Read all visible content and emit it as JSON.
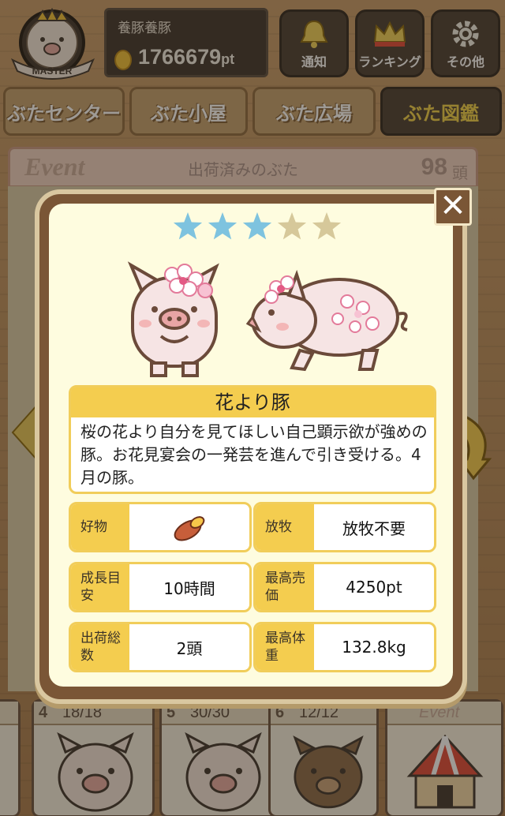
{
  "header": {
    "badge_text": "MASTER",
    "user_name": "養豚養豚",
    "points": "1766679",
    "points_unit": "pt",
    "buttons": [
      {
        "label": "通知",
        "icon": "bell-icon"
      },
      {
        "label": "ランキング",
        "icon": "crown-icon"
      },
      {
        "label": "その他",
        "icon": "gear-icon"
      }
    ]
  },
  "tabs": [
    {
      "label": "ぶたセンター",
      "active": false
    },
    {
      "label": "ぶた小屋",
      "active": false
    },
    {
      "label": "ぶた広場",
      "active": false
    },
    {
      "label": "ぶた図鑑",
      "active": true
    }
  ],
  "event_bar": {
    "event_label": "Event",
    "title": "出荷済みのぶた",
    "count": "98",
    "count_unit": "頭"
  },
  "bottom_cards": [
    {
      "number": "4",
      "count": "18/18"
    },
    {
      "number": "5",
      "count": "30/30"
    },
    {
      "number": "6",
      "count": "12/12"
    },
    {
      "number": "",
      "count": "Event"
    }
  ],
  "modal": {
    "close_label": "✕",
    "rating": {
      "filled": 3,
      "total": 5
    },
    "pig_name": "花より豚",
    "description": "桜の花より自分を見てほしい自己顕示欲が強めの豚。お花見宴会の一発芸を進んで引き受ける。4月の豚。",
    "stats": {
      "favorite": {
        "key": "好物",
        "value_icon": "sweet-potato-icon"
      },
      "grazing": {
        "key": "放牧",
        "value": "放牧不要"
      },
      "growth": {
        "key": "成長目安",
        "value": "10時間"
      },
      "max_price": {
        "key": "最高売価",
        "value": "4250pt"
      },
      "shipped": {
        "key": "出荷総数",
        "value": "2頭"
      },
      "max_weight": {
        "key": "最高体重",
        "value": "132.8kg"
      }
    }
  },
  "colors": {
    "star_filled": "#7ec3df",
    "star_empty": "#d6c89a",
    "accent_yellow": "#f4cd4f",
    "modal_frame": "#7a5636",
    "modal_bg": "#fefcdf"
  }
}
